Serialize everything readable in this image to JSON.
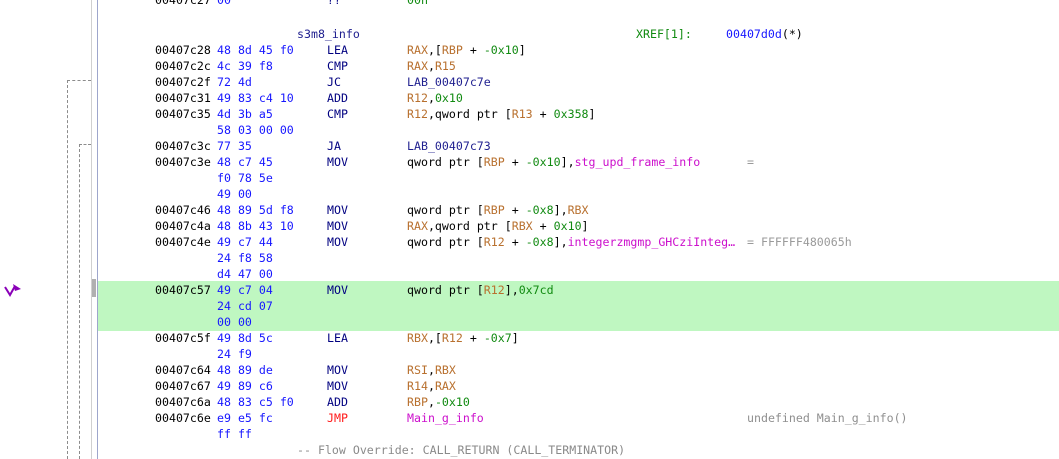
{
  "listing": {
    "top_partial": {
      "addr": "00407c27",
      "bytes": "00",
      "mn": "??",
      "op": "00h"
    },
    "label_line": {
      "name": "s3m8_info",
      "xref_label": "XREF[1]:",
      "xref_addr": "00407d0d",
      "xref_suffix": "(*)"
    },
    "rows": [
      {
        "addr": "00407c28",
        "bytes": "48 8d 45 f0",
        "mn": "LEA",
        "op": [
          "RAX",
          ",[",
          "RBP",
          " + ",
          "-0x10",
          "]"
        ]
      },
      {
        "addr": "00407c2c",
        "bytes": "4c 39 f8",
        "mn": "CMP",
        "op": [
          "RAX",
          ",",
          "R15"
        ]
      },
      {
        "addr": "00407c2f",
        "bytes": "72 4d",
        "mn": "JC",
        "op": [
          "LAB_00407c7e"
        ]
      },
      {
        "addr": "00407c31",
        "bytes": "49 83 c4 10",
        "mn": "ADD",
        "op": [
          "R12",
          ",",
          "0x10"
        ]
      },
      {
        "addr": "00407c35",
        "bytes": "4d 3b a5",
        "mn": "CMP",
        "op": [
          "R12",
          ",qword ptr [",
          "R13",
          " + ",
          "0x358",
          "]"
        ],
        "bytes2": "58 03 00 00"
      },
      {
        "addr": "00407c3c",
        "bytes": "77 35",
        "mn": "JA",
        "op": [
          "LAB_00407c73"
        ]
      },
      {
        "addr": "00407c3e",
        "bytes": "48 c7 45",
        "mn": "MOV",
        "op": [
          "qword ptr [",
          "RBP",
          " + ",
          "-0x10",
          "],",
          "stg_upd_frame_info"
        ],
        "eq": "=",
        "bytes2": "f0 78 5e",
        "bytes3": "49 00"
      },
      {
        "addr": "00407c46",
        "bytes": "48 89 5d f8",
        "mn": "MOV",
        "op": [
          "qword ptr [",
          "RBP",
          " + ",
          "-0x8",
          "],",
          "RBX"
        ]
      },
      {
        "addr": "00407c4a",
        "bytes": "48 8b 43 10",
        "mn": "MOV",
        "op": [
          "RAX",
          ",qword ptr [",
          "RBX",
          " + ",
          "0x10",
          "]"
        ]
      },
      {
        "addr": "00407c4e",
        "bytes": "49 c7 44",
        "mn": "MOV",
        "op": [
          "qword ptr [",
          "R12",
          " + ",
          "-0x8",
          "],",
          "integerzmgmp_GHCziInteg…"
        ],
        "eq": "= FFFFFF480065h",
        "bytes2": "24 f8 58",
        "bytes3": "d4 47 00"
      },
      {
        "addr": "00407c57",
        "bytes": "49 c7 04",
        "mn": "MOV",
        "op": [
          "qword ptr [",
          "R12",
          "],",
          "0x7cd"
        ],
        "bytes2": "24 cd 07",
        "bytes3": "00 00"
      },
      {
        "addr": "00407c5f",
        "bytes": "49 8d 5c",
        "mn": "LEA",
        "op": [
          "RBX",
          ",[",
          "R12",
          " + ",
          "-0x7",
          "]"
        ],
        "bytes2": "24 f9"
      },
      {
        "addr": "00407c64",
        "bytes": "48 89 de",
        "mn": "MOV",
        "op": [
          "RSI",
          ",",
          "RBX"
        ]
      },
      {
        "addr": "00407c67",
        "bytes": "49 89 c6",
        "mn": "MOV",
        "op": [
          "R14",
          ",",
          "RAX"
        ]
      },
      {
        "addr": "00407c6a",
        "bytes": "48 83 c5 f0",
        "mn": "ADD",
        "op": [
          "RBP",
          ",",
          "-0x10"
        ]
      },
      {
        "addr": "00407c6e",
        "bytes": "e9 e5 fc",
        "mn": "JMP",
        "op": [
          "Main_g_info"
        ],
        "comment": "undefined Main_g_info()",
        "bytes2": "ff ff"
      }
    ],
    "flow_override": "-- Flow Override: CALL_RETURN (CALL_TERMINATOR)"
  },
  "icons": {
    "marker": "checkmark-arrow-icon"
  },
  "colors": {
    "highlight": "#bff7c1",
    "bytes": "#1616ff",
    "register": "#b8702e",
    "number": "#108a10",
    "symbol": "#cc10cc",
    "jump": "#ff1a1a"
  }
}
